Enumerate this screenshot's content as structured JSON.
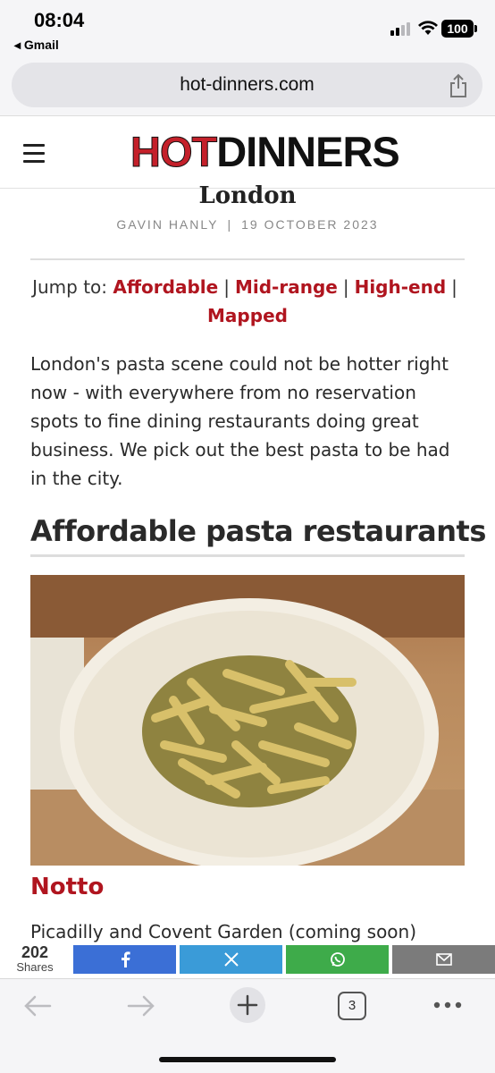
{
  "status_bar": {
    "time": "08:04",
    "back_app": "◂ Gmail",
    "battery": "100"
  },
  "browser": {
    "url": "hot-dinners.com",
    "tab_count": "3"
  },
  "site": {
    "logo_hot": "HOT",
    "logo_dinners": "DINNERS",
    "brand_color": "#c4202a"
  },
  "article": {
    "title_partial": "London",
    "author": "GAVIN HANLY",
    "byline_sep": "|",
    "date": "19 OCTOBER 2023",
    "jump_label": "Jump to:",
    "jump_links": [
      "Affordable",
      "Mid-range",
      "High-end",
      "Mapped"
    ],
    "intro": "London's pasta scene could not be hotter right now - with everywhere from no reservation spots to fine dining restaurants doing great business. We pick out the best pasta to be had in the city.",
    "section_heading": "Affordable pasta restaurants",
    "restaurant_name": "Notto",
    "restaurant_location": "Picadilly and Covent Garden (coming soon)"
  },
  "share_bar": {
    "count": "202",
    "label": "Shares",
    "buttons": [
      {
        "name": "facebook",
        "color": "#3b6fd6"
      },
      {
        "name": "x",
        "color": "#3a9bd8"
      },
      {
        "name": "whatsapp",
        "color": "#3eab4a"
      },
      {
        "name": "email",
        "color": "#7b7b7b"
      }
    ]
  }
}
